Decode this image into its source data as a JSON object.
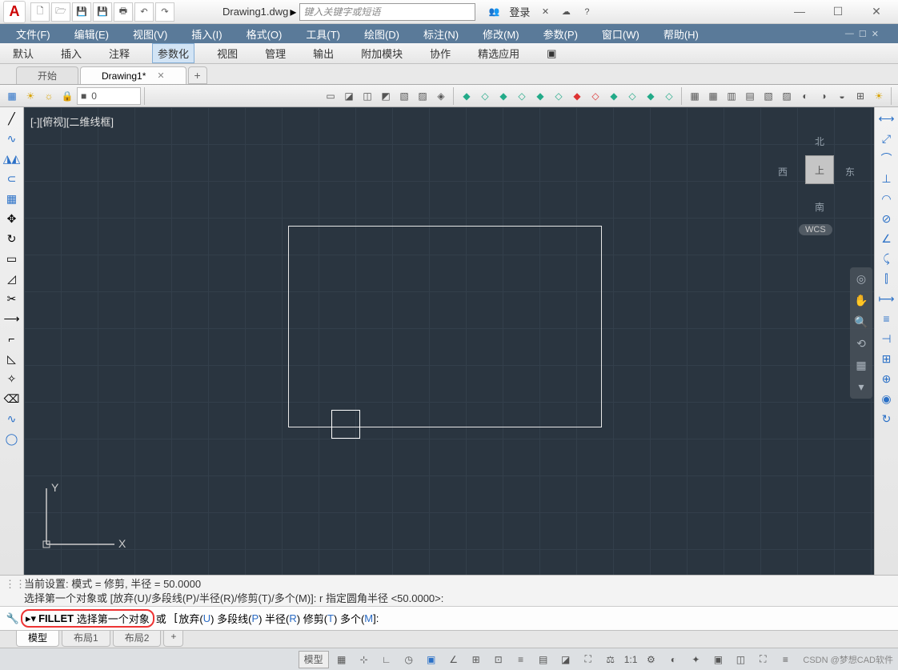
{
  "title": "Drawing1.dwg",
  "search_placeholder": "键入关键字或短语",
  "login": "登录",
  "winctrl": {
    "min": "—",
    "max": "☐",
    "close": "✕"
  },
  "menus": [
    "文件(F)",
    "编辑(E)",
    "视图(V)",
    "插入(I)",
    "格式(O)",
    "工具(T)",
    "绘图(D)",
    "标注(N)",
    "修改(M)",
    "参数(P)",
    "窗口(W)",
    "帮助(H)"
  ],
  "ribbon": [
    "默认",
    "插入",
    "注释",
    "参数化",
    "视图",
    "管理",
    "输出",
    "附加模块",
    "协作",
    "精选应用"
  ],
  "ribbon_active": 3,
  "tabs": {
    "start": "开始",
    "active": "Drawing1*",
    "plus": "+"
  },
  "layer_pill": "0",
  "viewport_label": "[-][俯视][二维线框]",
  "navcube": {
    "n": "北",
    "s": "南",
    "e": "东",
    "w": "西",
    "top": "上",
    "wcs": "WCS"
  },
  "cmd_history": [
    "当前设置: 模式 = 修剪, 半径 = 50.0000",
    "选择第一个对象或 [放弃(U)/多段线(P)/半径(R)/修剪(T)/多个(M)]: r 指定圆角半径 <50.0000>:"
  ],
  "cmd": {
    "name": "FILLET",
    "prompt": "选择第一个对象",
    "suffix": "或",
    "opts": [
      "放弃(",
      "U",
      ") 多段线(",
      "P",
      ") 半径(",
      "R",
      ") 修剪(",
      "T",
      ") 多个(",
      "M",
      ")"
    ],
    "tail": "]:"
  },
  "bottom_tabs": [
    "模型",
    "布局1",
    "布局2",
    "+"
  ],
  "status": {
    "label": "模型",
    "scale": "1:1"
  },
  "watermark": "CSDN @梦想CAD软件"
}
